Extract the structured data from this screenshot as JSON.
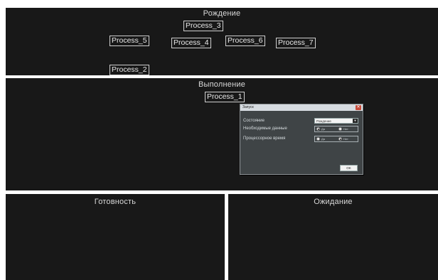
{
  "panels": {
    "birth": {
      "title": "Рождение"
    },
    "execution": {
      "title": "Выполнение"
    },
    "ready": {
      "title": "Готовность"
    },
    "waiting": {
      "title": "Ожидание"
    }
  },
  "processes": {
    "birth": [
      "Process_3",
      "Process_5",
      "Process_4",
      "Process_6",
      "Process_7",
      "Process_2"
    ],
    "execution": [
      "Process_1"
    ]
  },
  "dialog": {
    "title": "Запуск",
    "close_glyph": "✕",
    "state_label": "Состояние",
    "state_value": "Рождение",
    "state_arrow": "▼",
    "data_label": "Необходимые данные",
    "data_options": [
      "Да",
      "Нет"
    ],
    "data_selected": "Да",
    "cpu_label": "Процессорное время",
    "cpu_options": [
      "Да",
      "Нет"
    ],
    "cpu_selected": "Нет",
    "ok_label": "OK"
  },
  "colors": {
    "panel_bg": "#181818",
    "panel_text": "#d9d9d9",
    "dialog_bg": "#3f4446"
  }
}
